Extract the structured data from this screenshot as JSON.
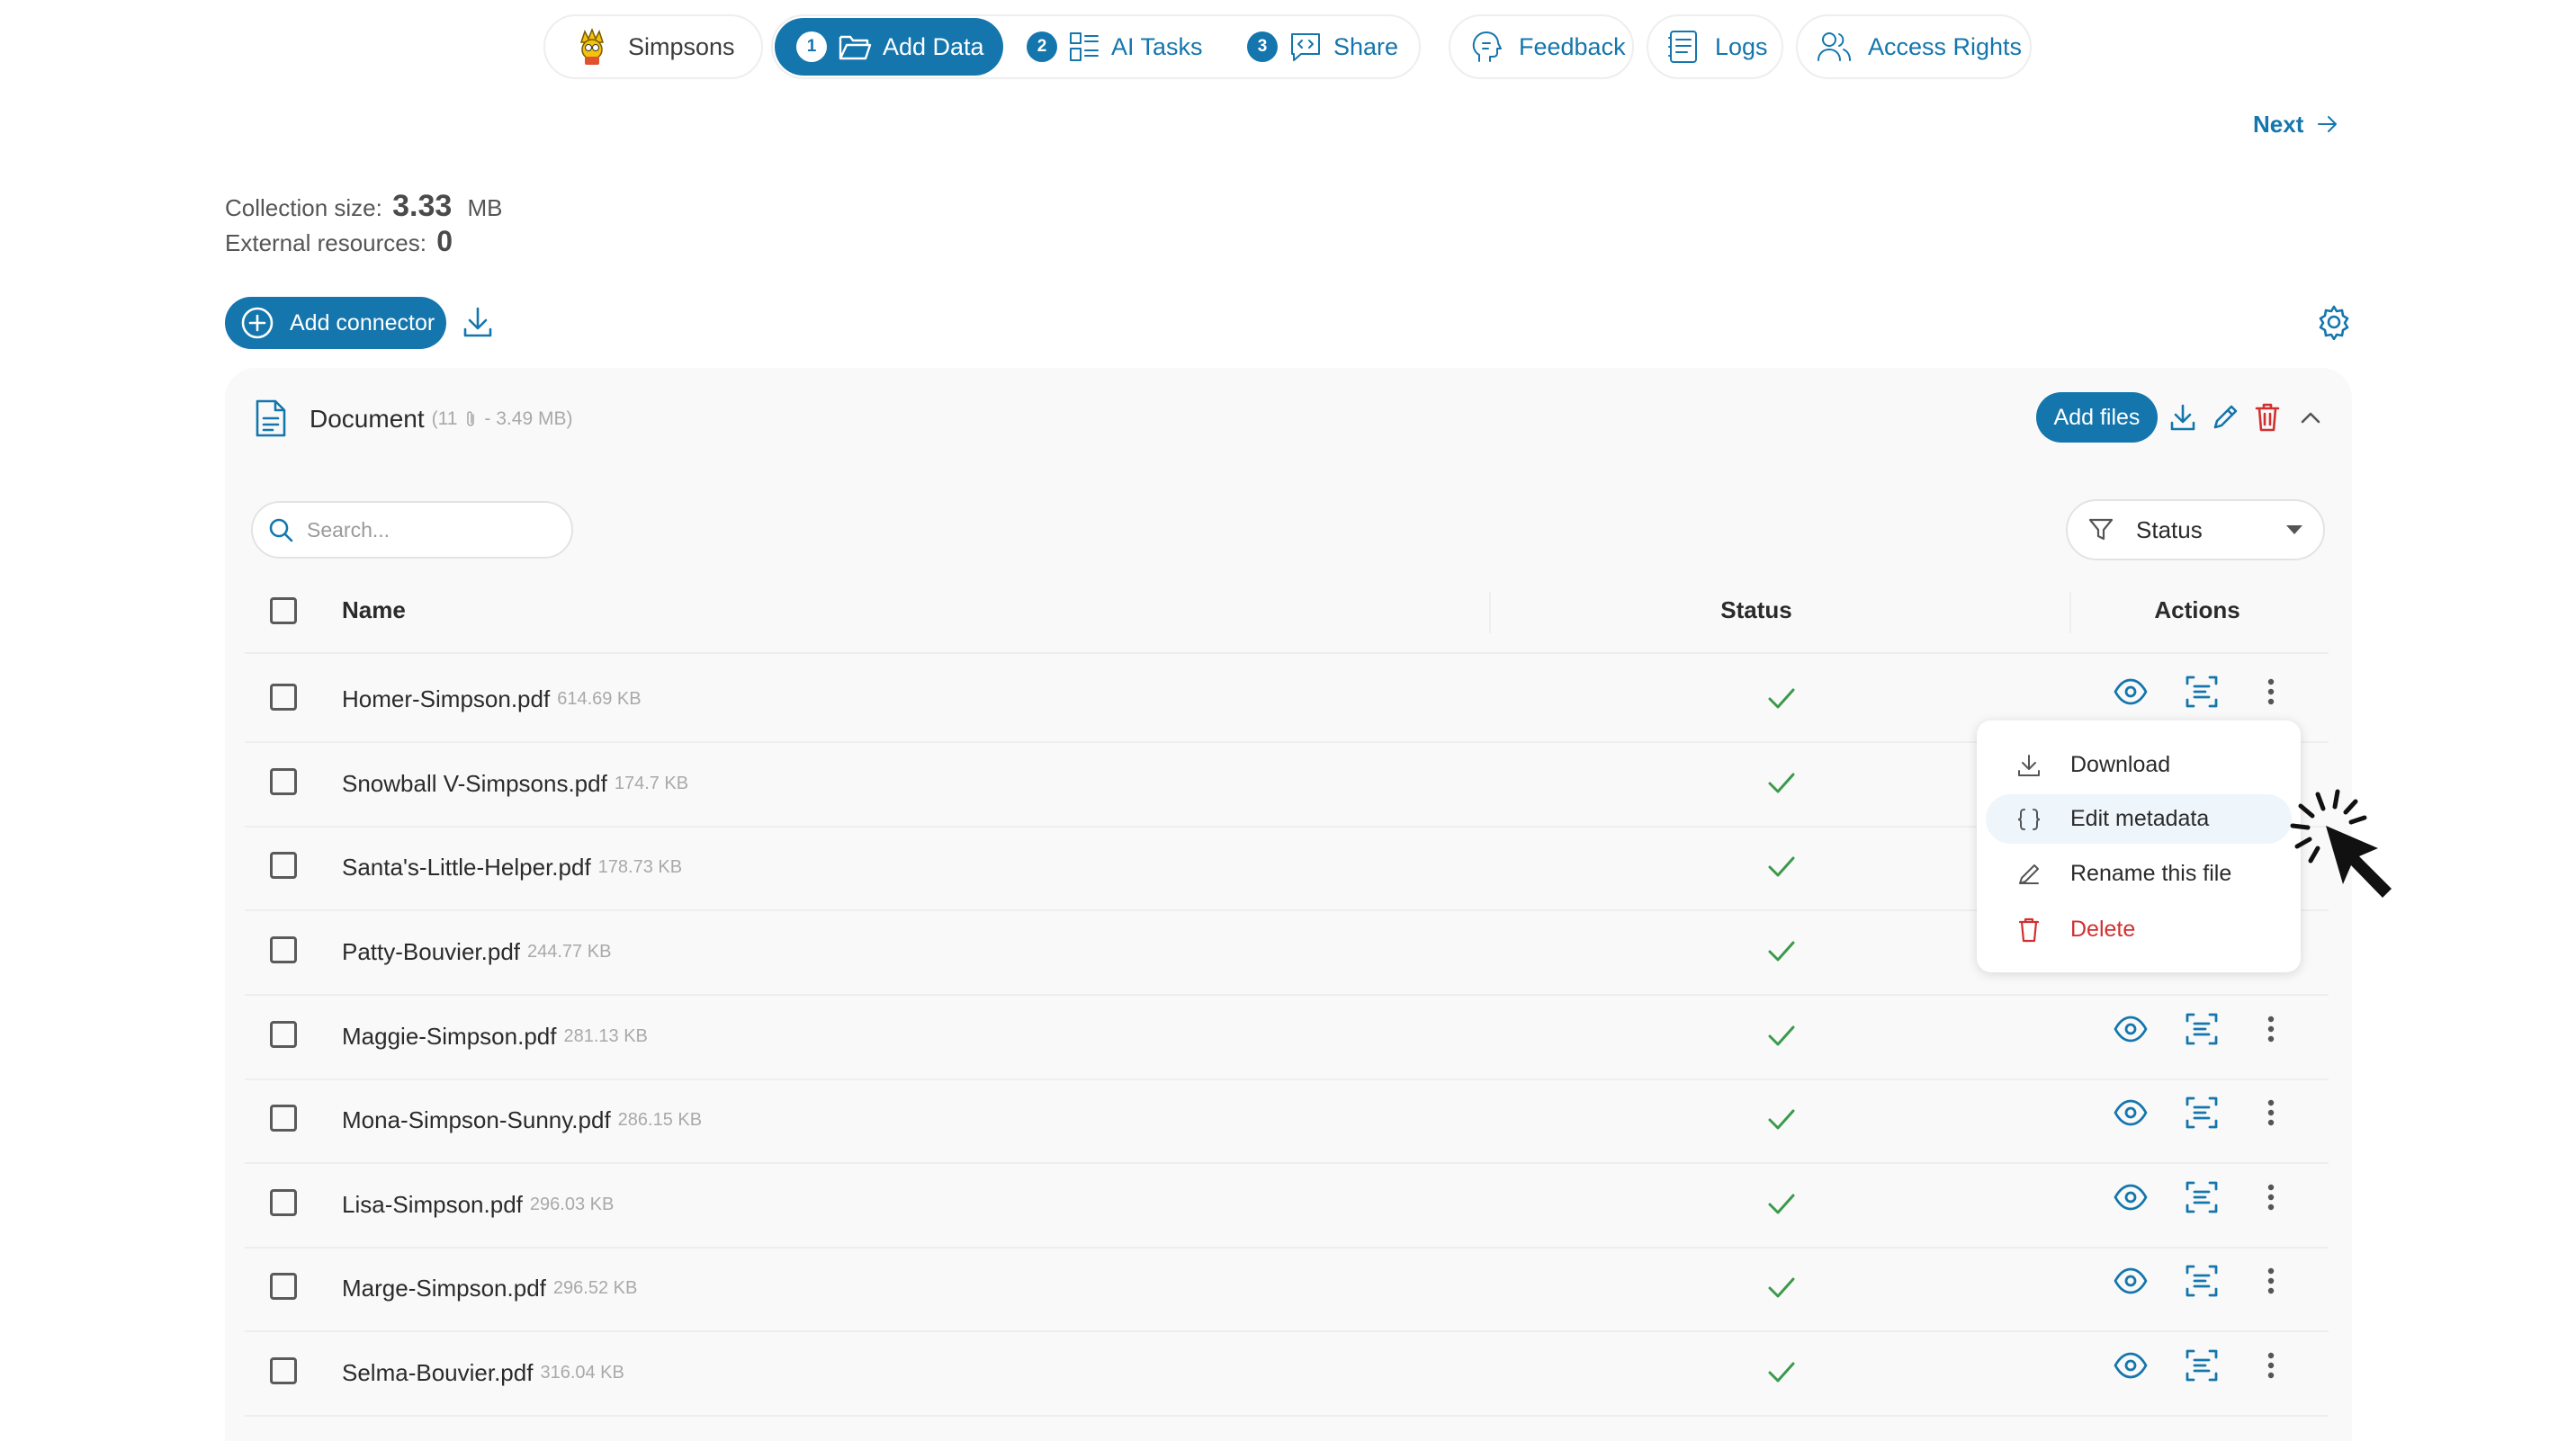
{
  "nav": {
    "project": "Simpsons",
    "steps": [
      {
        "number": "1",
        "label": "Add Data"
      },
      {
        "number": "2",
        "label": "AI Tasks"
      },
      {
        "number": "3",
        "label": "Share"
      }
    ],
    "feedback": "Feedback",
    "logs": "Logs",
    "access_rights": "Access Rights"
  },
  "next_label": "Next",
  "stats": {
    "collection_label": "Collection size:",
    "collection_value": "3.33",
    "collection_unit": "MB",
    "external_label": "External resources:",
    "external_value": "0"
  },
  "add_connector": "Add connector",
  "document": {
    "title": "Document",
    "count_open": "(11",
    "size_close": "- 3.49 MB)",
    "add_files": "Add files"
  },
  "search": {
    "placeholder": "Search..."
  },
  "status_filter": "Status",
  "table": {
    "col_name": "Name",
    "col_status": "Status",
    "col_actions": "Actions",
    "rows": [
      {
        "name": "Homer-Simpson.pdf",
        "size": "614.69 KB"
      },
      {
        "name": "Snowball V-Simpsons.pdf",
        "size": "174.7 KB"
      },
      {
        "name": "Santa's-Little-Helper.pdf",
        "size": "178.73 KB"
      },
      {
        "name": "Patty-Bouvier.pdf",
        "size": "244.77 KB"
      },
      {
        "name": "Maggie-Simpson.pdf",
        "size": "281.13 KB"
      },
      {
        "name": "Mona-Simpson-Sunny.pdf",
        "size": "286.15 KB"
      },
      {
        "name": "Lisa-Simpson.pdf",
        "size": "296.03 KB"
      },
      {
        "name": "Marge-Simpson.pdf",
        "size": "296.52 KB"
      },
      {
        "name": "Selma-Bouvier.pdf",
        "size": "316.04 KB"
      }
    ]
  },
  "menu": {
    "download": "Download",
    "edit_metadata": "Edit metadata",
    "rename": "Rename this file",
    "delete": "Delete"
  },
  "colors": {
    "accent": "#1476ad",
    "success": "#3a9a4a",
    "danger": "#d32f2f"
  },
  "icons": [
    "simpsons-logo-icon",
    "folder-open-icon",
    "ai-tasks-icon",
    "share-code-icon",
    "feedback-head-icon",
    "logs-icon",
    "users-icon",
    "arrow-right-icon",
    "plus-circle-icon",
    "download-icon",
    "settings-gear-icon",
    "document-icon",
    "paperclip-icon",
    "pencil-icon",
    "trash-icon",
    "chevron-up-icon",
    "search-icon",
    "filter-funnel-icon",
    "caret-down-icon",
    "check-icon",
    "eye-icon",
    "scan-text-icon",
    "more-vertical-icon",
    "curly-braces-icon",
    "cursor-click-icon"
  ]
}
